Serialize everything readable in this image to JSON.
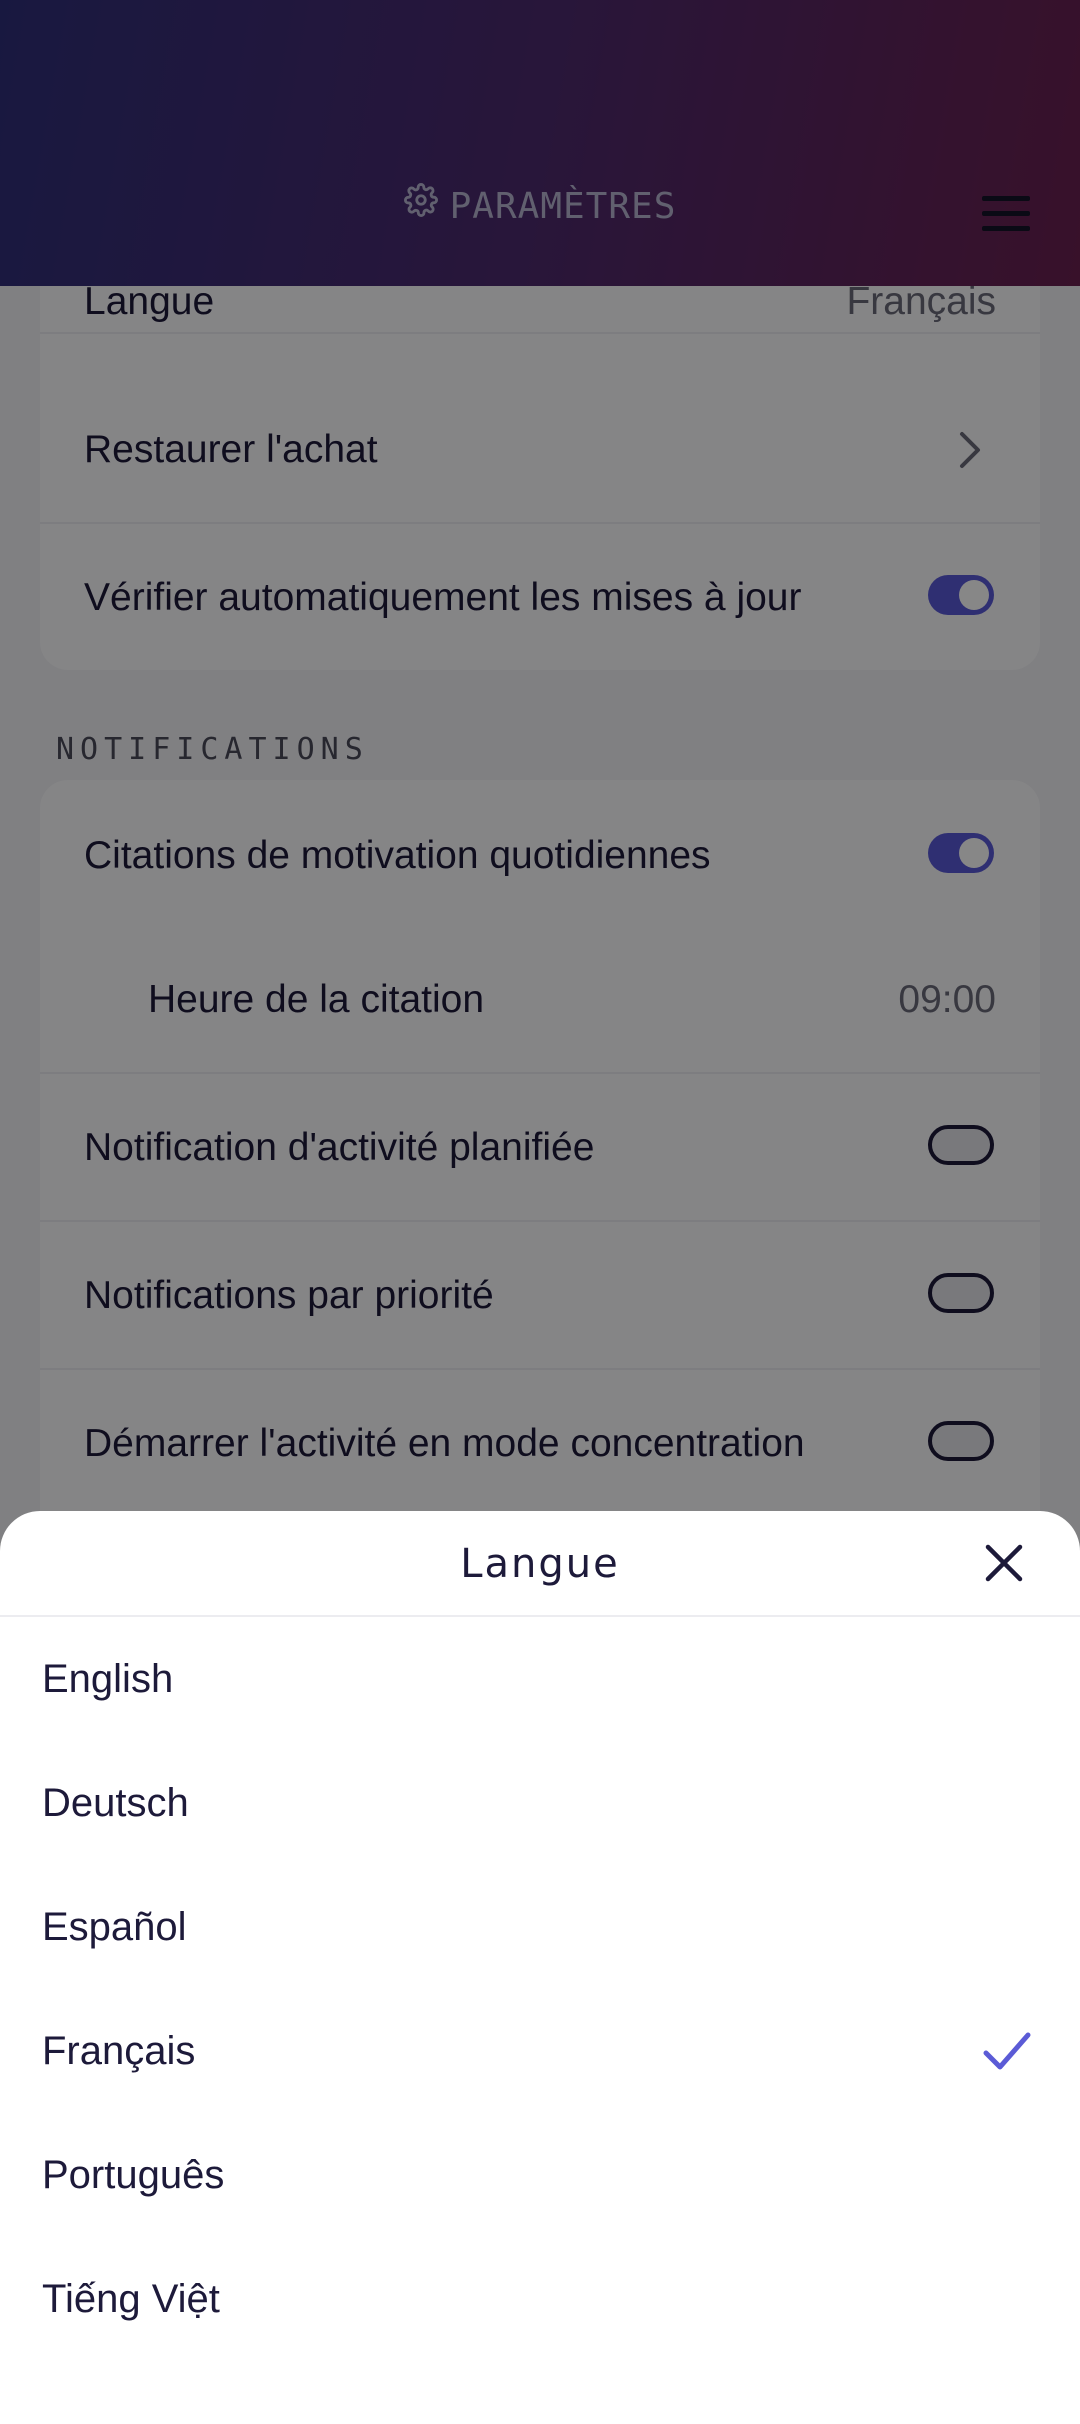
{
  "header": {
    "title": "PARAMÈTRES"
  },
  "general": {
    "language_label": "Langue",
    "language_value": "Français",
    "restore_label": "Restaurer l'achat",
    "auto_update_label": "Vérifier automatiquement les mises à jour"
  },
  "notifications": {
    "section_title": "NOTIFICATIONS",
    "daily_quotes_label": "Citations de motivation quotidiennes",
    "quote_time_label": "Heure de la citation",
    "quote_time_value": "09:00",
    "scheduled_label": "Notification d'activité planifiée",
    "priority_label": "Notifications par priorité",
    "focus_mode_label": "Démarrer l'activité en mode concentration"
  },
  "sheet": {
    "title": "Langue",
    "languages": [
      "English",
      "Deutsch",
      "Español",
      "Français",
      "Português",
      "Tiếng Việt"
    ],
    "selected": "Français"
  },
  "colors": {
    "accent": "#5a5ad8",
    "check": "#5b5bd6",
    "text": "#1d1a3a"
  }
}
